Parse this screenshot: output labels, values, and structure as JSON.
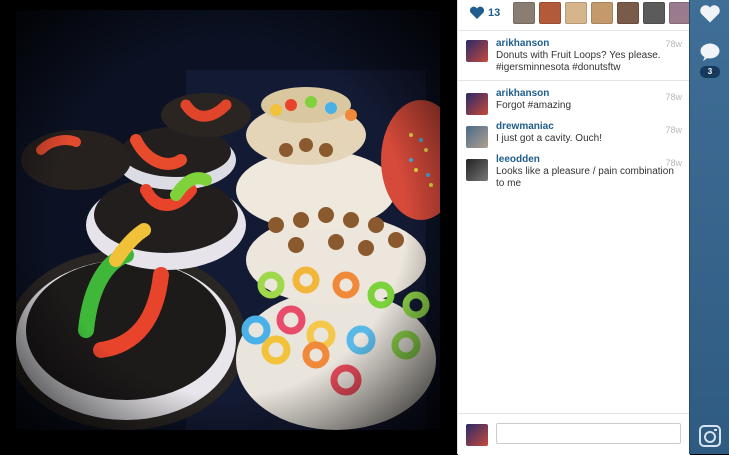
{
  "likes": {
    "count": "13"
  },
  "likers": [
    {
      "color": "#8a7d74"
    },
    {
      "color": "#b35a3a"
    },
    {
      "color": "#d6b48c"
    },
    {
      "color": "#c49a6c"
    },
    {
      "color": "#7a5a48"
    },
    {
      "color": "#5b5b5b"
    },
    {
      "color": "#9a7b8d"
    },
    {
      "color": "#7e9c5c"
    }
  ],
  "caption": {
    "user": "arikhanson",
    "text": "Donuts with Fruit Loops? Yes please. #igersminnesota #donutsftw",
    "time": "78w"
  },
  "comments": [
    {
      "user": "arikhanson",
      "text": "Forgot #amazing",
      "time": "78w"
    },
    {
      "user": "drewmaniac",
      "text": "I just got a cavity. Ouch!",
      "time": "78w"
    },
    {
      "user": "leeodden",
      "text": "Looks like a pleasure / pain combination to me",
      "time": "78w"
    }
  ],
  "input": {
    "placeholder": ""
  },
  "rail": {
    "comment_count": "3"
  },
  "colors": {
    "accent": "#1e5d8c",
    "rail": "#3a6890"
  }
}
